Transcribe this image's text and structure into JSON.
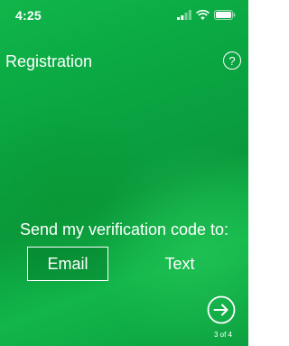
{
  "status_bar": {
    "time": "4:25",
    "icons": [
      "signal-icon",
      "wifi-icon",
      "battery-icon"
    ]
  },
  "header": {
    "title": "Registration",
    "help_label": "?"
  },
  "main": {
    "prompt": "Send my verification code to:",
    "options": [
      {
        "label": "Email",
        "selected": true
      },
      {
        "label": "Text",
        "selected": false
      }
    ]
  },
  "footer": {
    "next_icon": "arrow-right-circle-icon",
    "progress": "3 of 4"
  },
  "colors": {
    "background": "#0aa642",
    "foreground": "#ffffff"
  }
}
